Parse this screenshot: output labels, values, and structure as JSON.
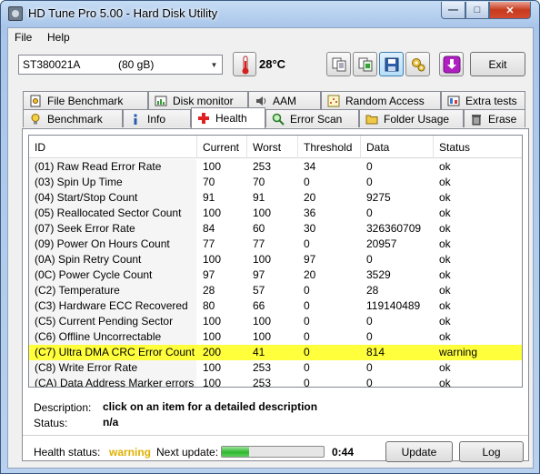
{
  "window": {
    "title": "HD Tune Pro 5.00 - Hard Disk Utility",
    "minimize_glyph": "—",
    "maximize_glyph": "□",
    "close_glyph": "✕"
  },
  "menu": {
    "file": "File",
    "help": "Help"
  },
  "toolbar": {
    "drive_name": "ST380021A",
    "drive_size": "(80 gB)",
    "temperature": "28",
    "temperature_unit": "°C",
    "exit_label": "Exit",
    "icons": [
      "copy-info-icon",
      "copy-screenshot-icon",
      "save-icon",
      "options-icon",
      "download-icon"
    ]
  },
  "tabs": {
    "top": [
      {
        "label": "File Benchmark",
        "icon": "file-benchmark-icon"
      },
      {
        "label": "Disk monitor",
        "icon": "disk-monitor-icon"
      },
      {
        "label": "AAM",
        "icon": "speaker-icon"
      },
      {
        "label": "Random Access",
        "icon": "random-access-icon"
      },
      {
        "label": "Extra tests",
        "icon": "extra-tests-icon"
      }
    ],
    "bottom": [
      {
        "label": "Benchmark",
        "icon": "bulb-icon"
      },
      {
        "label": "Info",
        "icon": "info-icon"
      },
      {
        "label": "Health",
        "icon": "health-cross-icon"
      },
      {
        "label": "Error Scan",
        "icon": "magnifier-icon"
      },
      {
        "label": "Folder Usage",
        "icon": "folder-icon"
      },
      {
        "label": "Erase",
        "icon": "trash-icon"
      }
    ],
    "selected": "Health"
  },
  "table": {
    "columns": [
      "ID",
      "Current",
      "Worst",
      "Threshold",
      "Data",
      "Status"
    ],
    "rows": [
      [
        "(01) Raw Read Error Rate",
        "100",
        "253",
        "34",
        "0",
        "ok"
      ],
      [
        "(03) Spin Up Time",
        "70",
        "70",
        "0",
        "0",
        "ok"
      ],
      [
        "(04) Start/Stop Count",
        "91",
        "91",
        "20",
        "9275",
        "ok"
      ],
      [
        "(05) Reallocated Sector Count",
        "100",
        "100",
        "36",
        "0",
        "ok"
      ],
      [
        "(07) Seek Error Rate",
        "84",
        "60",
        "30",
        "326360709",
        "ok"
      ],
      [
        "(09) Power On Hours Count",
        "77",
        "77",
        "0",
        "20957",
        "ok"
      ],
      [
        "(0A) Spin Retry Count",
        "100",
        "100",
        "97",
        "0",
        "ok"
      ],
      [
        "(0C) Power Cycle Count",
        "97",
        "97",
        "20",
        "3529",
        "ok"
      ],
      [
        "(C2) Temperature",
        "28",
        "57",
        "0",
        "28",
        "ok"
      ],
      [
        "(C3) Hardware ECC Recovered",
        "80",
        "66",
        "0",
        "119140489",
        "ok"
      ],
      [
        "(C5) Current Pending Sector",
        "100",
        "100",
        "0",
        "0",
        "ok"
      ],
      [
        "(C6) Offline Uncorrectable",
        "100",
        "100",
        "0",
        "0",
        "ok"
      ],
      [
        "(C7) Ultra DMA CRC Error Count",
        "200",
        "41",
        "0",
        "814",
        "warning"
      ],
      [
        "(C8) Write Error Rate",
        "100",
        "253",
        "0",
        "0",
        "ok"
      ],
      [
        "(CA) Data Address Marker errors",
        "100",
        "253",
        "0",
        "0",
        "ok"
      ]
    ],
    "highlight_color": "#ffff3c"
  },
  "description": {
    "description_label": "Description:",
    "description_value": "click on an item for a detailed description",
    "status_label": "Status:",
    "status_value": "n/a"
  },
  "footer": {
    "health_label": "Health status:",
    "health_value": "warning",
    "health_color": "#e0b000",
    "next_update_label": "Next update:",
    "progress_fraction": 0.27,
    "countdown": "0:44",
    "update_label": "Update",
    "log_label": "Log"
  }
}
